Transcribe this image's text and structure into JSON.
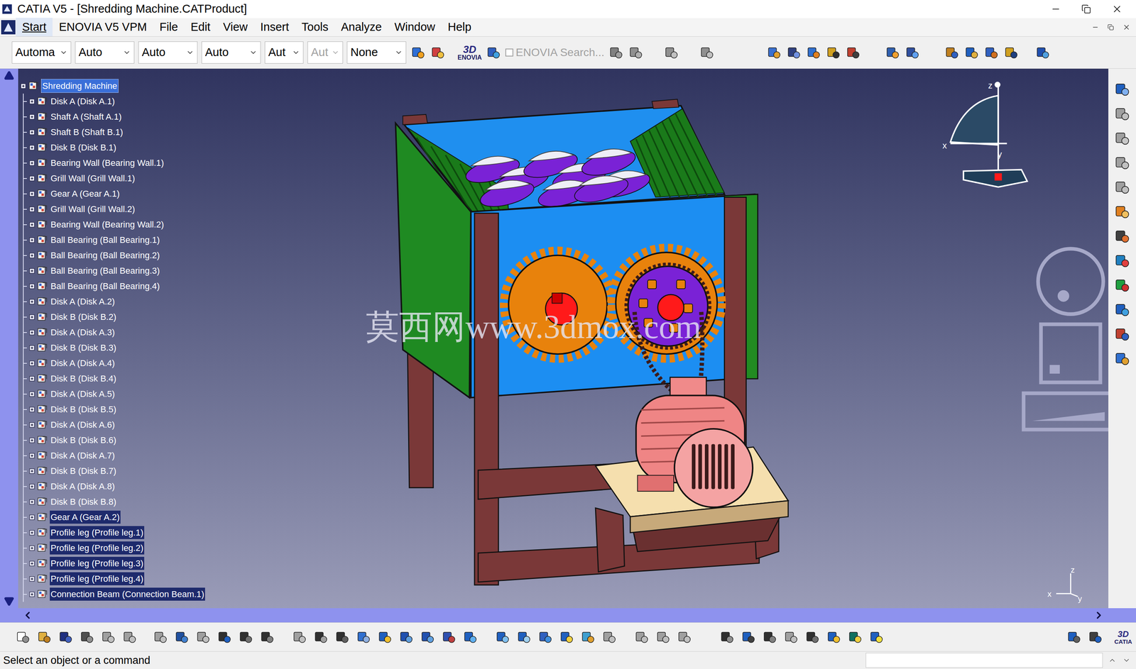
{
  "window": {
    "title": "CATIA V5 - [Shredding Machine.CATProduct]"
  },
  "menu": [
    {
      "label": "Start",
      "selected": true
    },
    {
      "label": "ENOVIA V5 VPM",
      "selected": false
    },
    {
      "label": "File",
      "selected": false
    },
    {
      "label": "Edit",
      "selected": false
    },
    {
      "label": "View",
      "selected": false
    },
    {
      "label": "Insert",
      "selected": false
    },
    {
      "label": "Tools",
      "selected": false
    },
    {
      "label": "Analyze",
      "selected": false
    },
    {
      "label": "Window",
      "selected": false
    },
    {
      "label": "Help",
      "selected": false
    }
  ],
  "toolbar": {
    "dropdowns": [
      {
        "value": "Automa",
        "disabled": false
      },
      {
        "value": "Auto",
        "disabled": false
      },
      {
        "value": "Auto",
        "disabled": false
      },
      {
        "value": "Auto",
        "disabled": false
      },
      {
        "value": "Aut",
        "disabled": false
      },
      {
        "value": "Aut",
        "disabled": true
      },
      {
        "value": "None",
        "disabled": false
      }
    ],
    "logo": "ENOVIA",
    "enovia_search": {
      "label": "ENOVIA Search...",
      "checked": false,
      "disabled": true
    }
  },
  "tree": {
    "root": {
      "label": "Shredding Machine",
      "selected": true
    },
    "items": [
      {
        "label": "Disk A (Disk A.1)",
        "selected": false
      },
      {
        "label": "Shaft A (Shaft A.1)",
        "selected": false
      },
      {
        "label": "Shaft B (Shaft B.1)",
        "selected": false
      },
      {
        "label": "Disk B (Disk B.1)",
        "selected": false
      },
      {
        "label": "Bearing Wall (Bearing Wall.1)",
        "selected": false
      },
      {
        "label": "Grill Wall (Grill Wall.1)",
        "selected": false
      },
      {
        "label": "Gear A (Gear A.1)",
        "selected": false
      },
      {
        "label": "Grill Wall (Grill Wall.2)",
        "selected": false
      },
      {
        "label": "Bearing Wall (Bearing Wall.2)",
        "selected": false
      },
      {
        "label": "Ball Bearing (Ball Bearing.1)",
        "selected": false
      },
      {
        "label": "Ball Bearing (Ball Bearing.2)",
        "selected": false
      },
      {
        "label": "Ball Bearing (Ball Bearing.3)",
        "selected": false
      },
      {
        "label": "Ball Bearing (Ball Bearing.4)",
        "selected": false
      },
      {
        "label": "Disk A (Disk A.2)",
        "selected": false
      },
      {
        "label": "Disk B (Disk B.2)",
        "selected": false
      },
      {
        "label": "Disk A (Disk A.3)",
        "selected": false
      },
      {
        "label": "Disk B (Disk B.3)",
        "selected": false
      },
      {
        "label": "Disk A (Disk A.4)",
        "selected": false
      },
      {
        "label": "Disk B (Disk B.4)",
        "selected": false
      },
      {
        "label": "Disk A (Disk A.5)",
        "selected": false
      },
      {
        "label": "Disk B (Disk B.5)",
        "selected": false
      },
      {
        "label": "Disk A (Disk A.6)",
        "selected": false
      },
      {
        "label": "Disk B (Disk B.6)",
        "selected": false
      },
      {
        "label": "Disk A (Disk A.7)",
        "selected": false
      },
      {
        "label": "Disk B (Disk B.7)",
        "selected": false
      },
      {
        "label": "Disk A (Disk A.8)",
        "selected": false
      },
      {
        "label": "Disk B (Disk B.8)",
        "selected": false
      },
      {
        "label": "Gear A (Gear A.2)",
        "selected": true
      },
      {
        "label": "Profile leg (Profile leg.1)",
        "selected": true
      },
      {
        "label": "Profile leg (Profile leg.2)",
        "selected": true
      },
      {
        "label": "Profile leg (Profile leg.3)",
        "selected": true
      },
      {
        "label": "Profile leg (Profile leg.4)",
        "selected": true
      },
      {
        "label": "Connection Beam (Connection Beam.1)",
        "selected": true
      }
    ]
  },
  "viewport": {
    "watermark": "莫西网www.3dmox.com",
    "compass_labels": [
      "z",
      "x",
      "y"
    ],
    "axis_labels": [
      "z",
      "x",
      "y"
    ]
  },
  "bottom_toolbar": {
    "logo": "CATIA"
  },
  "status_bar": {
    "text": "Select an object or a command"
  }
}
